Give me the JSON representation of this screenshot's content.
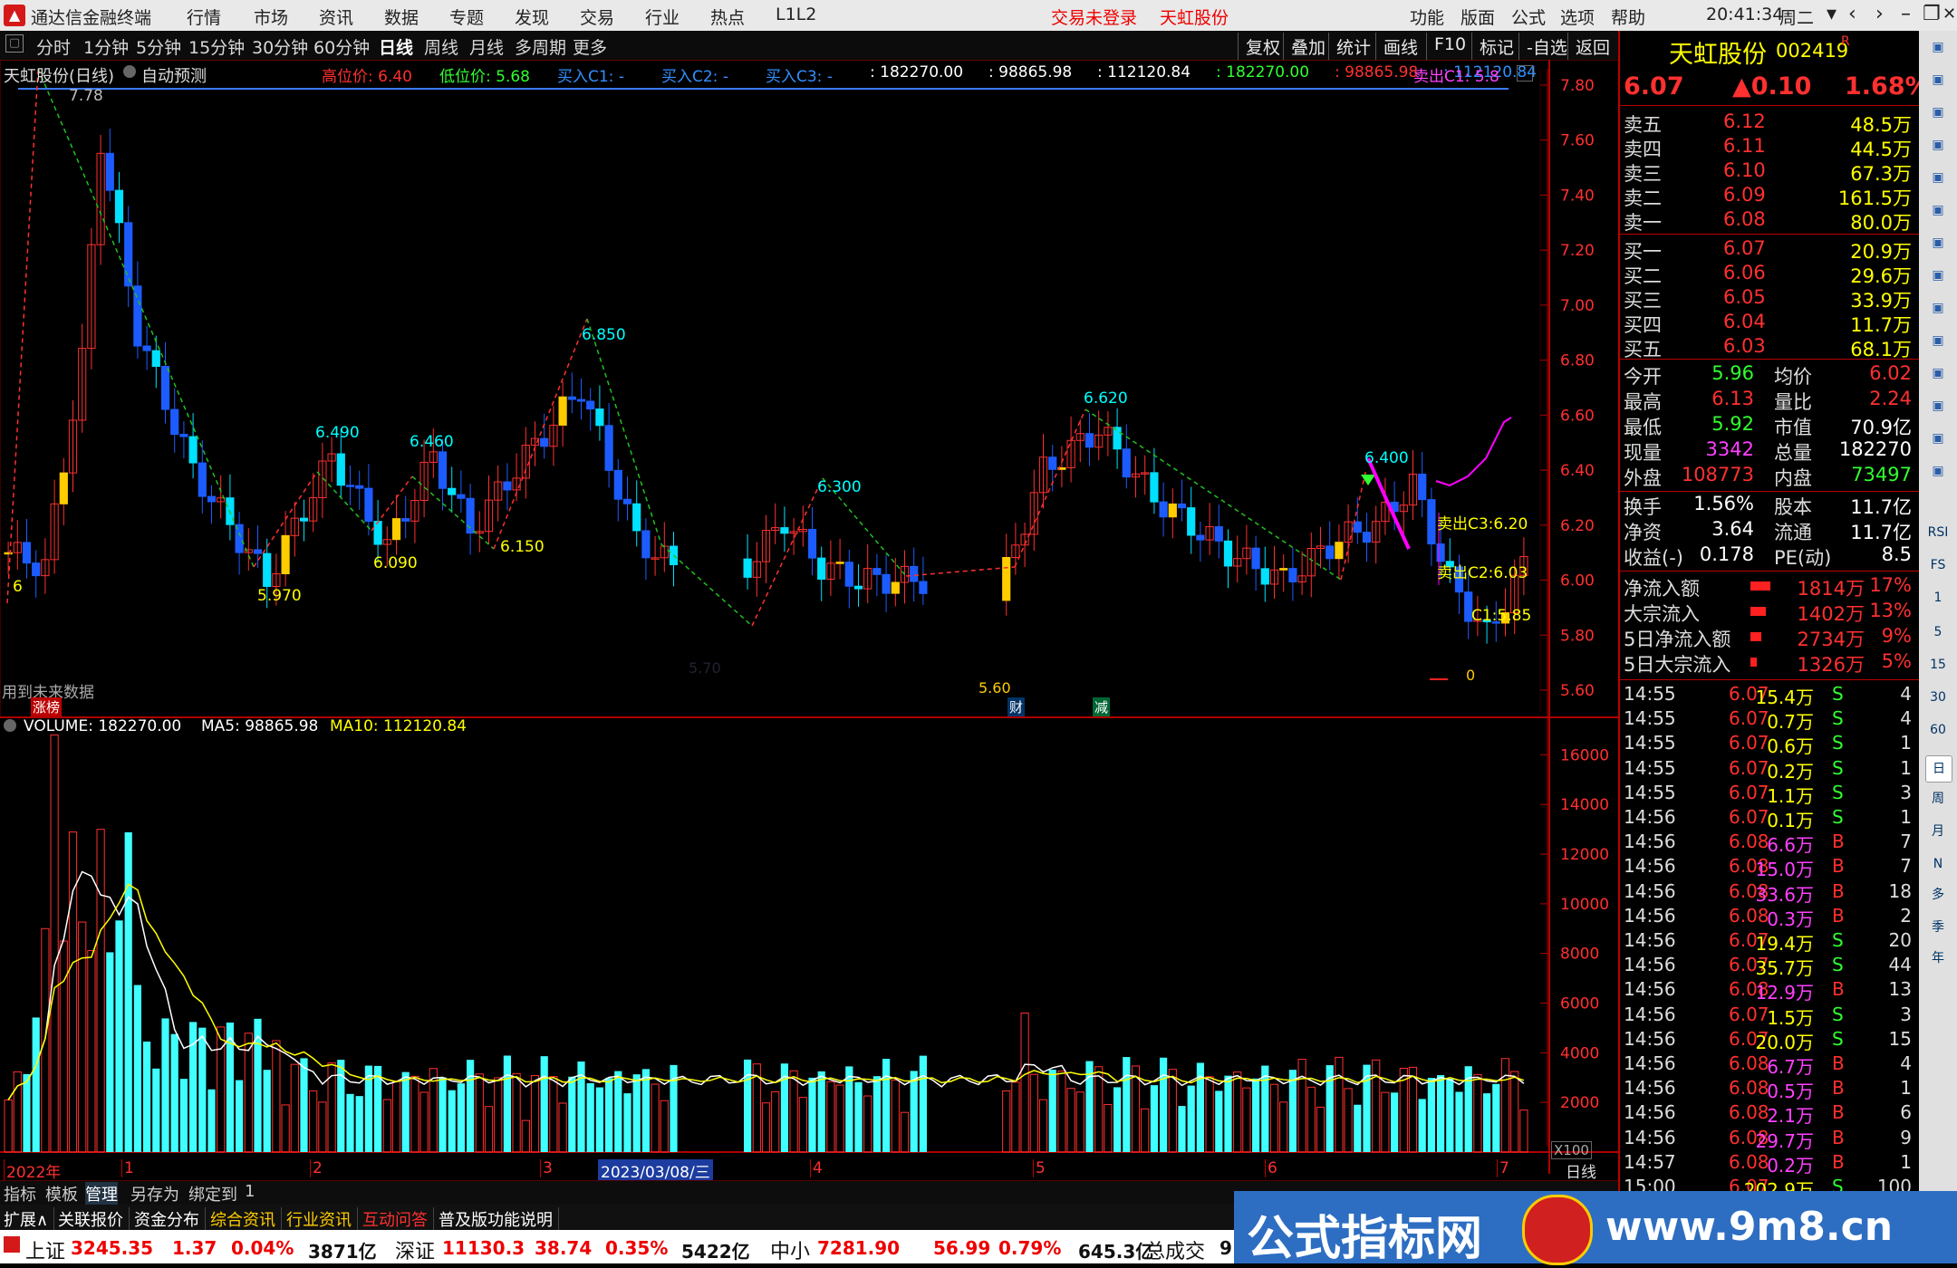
{
  "app": {
    "name": "通达信金融终端",
    "menu": [
      "行情",
      "市场",
      "资讯",
      "数据",
      "专题",
      "发现",
      "交易",
      "行业",
      "热点",
      "L1L2"
    ],
    "status_msg": "交易未登录",
    "stock_msg": "天虹股份",
    "right_menu": [
      "功能",
      "版面",
      "公式",
      "选项",
      "帮助"
    ],
    "clock": "20:41:34",
    "weekday": "周二"
  },
  "toolbar": {
    "periods": [
      "分时",
      "1分钟",
      "5分钟",
      "15分钟",
      "30分钟",
      "60分钟",
      "日线",
      "周线",
      "月线",
      "多周期",
      "更多"
    ],
    "active_period": "日线",
    "right_buttons": [
      "复权",
      "叠加",
      "统计",
      "画线",
      "F10",
      "标记",
      "-自选",
      "返回"
    ]
  },
  "chart": {
    "header_left": "天虹股份(日线)",
    "auto_predict": "自动预测",
    "info": [
      {
        "label": "高位价:",
        "value": "6.40",
        "color": "#ff3030"
      },
      {
        "label": "低位价:",
        "value": "5.68",
        "color": "#30ff30"
      },
      {
        "label": "买入C1:",
        "value": "-",
        "color": "#3090ff"
      },
      {
        "label": "买入C2:",
        "value": "-",
        "color": "#3090ff"
      },
      {
        "label": "买入C3:",
        "value": "-",
        "color": "#3090ff"
      },
      {
        "label": ":",
        "value": "182270.00",
        "color": "#ffffff"
      },
      {
        "label": ":",
        "value": "98865.98",
        "color": "#ffffff"
      },
      {
        "label": ":",
        "value": "112120.84",
        "color": "#ffffff"
      },
      {
        "label": ":",
        "value": "182270.00",
        "color": "#30ff30"
      },
      {
        "label": ":",
        "value": "98865.98",
        "color": "#ff3030"
      },
      {
        "label": ":",
        "value": "112120.84",
        "color": "#3090ff"
      }
    ],
    "sell_c1": "卖出C1: 5.8",
    "y_ticks": [
      "7.80",
      "7.60",
      "7.40",
      "7.20",
      "7.00",
      "6.80",
      "6.60",
      "6.40",
      "6.20",
      "6.00",
      "5.80",
      "5.60"
    ],
    "peak_labels": [
      "7.78",
      "6.490",
      "6.460",
      "6.850",
      "6.300",
      "6.620",
      "6.400"
    ],
    "trough_labels": [
      "6",
      "5.970",
      "6.090",
      "6.150",
      "5.60"
    ],
    "sell_labels": [
      "卖出C3:6.20",
      "卖出C2:6.03",
      "C1:5.85"
    ],
    "misc_labels": {
      "future_data": "用到未来数据",
      "zt": "涨榜",
      "cai": "财",
      "jian": "减",
      "low_ann": "5.60",
      "zero": "0",
      "bottom_price": "5.70"
    }
  },
  "volume": {
    "header": "VOLUME: 182270.00",
    "ma5": "MA5: 98865.98",
    "ma10": "MA10: 112120.84",
    "y_ticks": [
      "16000",
      "14000",
      "12000",
      "10000",
      "8000",
      "6000",
      "4000",
      "2000"
    ],
    "unit": "X100"
  },
  "time_axis": {
    "labels": [
      "2022年",
      "1",
      "2",
      "3",
      "4",
      "5",
      "6",
      "7"
    ],
    "cursor_date": "2023/03/08/三",
    "period": "日线"
  },
  "tabs_bottom": [
    "指标",
    "模板",
    "管理",
    "另存为",
    "绑定到",
    "1"
  ],
  "tabs_bottom2": [
    "扩展∧",
    "关联报价",
    "资金分布",
    "综合资讯",
    "行业资讯",
    "互动问答",
    "普及版功能说明"
  ],
  "stock": {
    "name": "天虹股份",
    "code": "002419",
    "badge": "R",
    "price": "6.07",
    "change": "▲0.10",
    "change_pct": "1.68%",
    "asks": [
      {
        "label": "卖五",
        "price": "6.12",
        "vol": "48.5万"
      },
      {
        "label": "卖四",
        "price": "6.11",
        "vol": "44.5万"
      },
      {
        "label": "卖三",
        "price": "6.10",
        "vol": "67.3万"
      },
      {
        "label": "卖二",
        "price": "6.09",
        "vol": "161.5万"
      },
      {
        "label": "卖一",
        "price": "6.08",
        "vol": "80.0万"
      }
    ],
    "bids": [
      {
        "label": "买一",
        "price": "6.07",
        "vol": "20.9万"
      },
      {
        "label": "买二",
        "price": "6.06",
        "vol": "29.6万"
      },
      {
        "label": "买三",
        "price": "6.05",
        "vol": "33.9万"
      },
      {
        "label": "买四",
        "price": "6.04",
        "vol": "11.7万"
      },
      {
        "label": "买五",
        "price": "6.03",
        "vol": "68.1万"
      }
    ],
    "stats": [
      {
        "l1": "今开",
        "v1": "5.96",
        "c1": "#30ff30",
        "l2": "均价",
        "v2": "6.02",
        "c2": "#ff3030"
      },
      {
        "l1": "最高",
        "v1": "6.13",
        "c1": "#ff3030",
        "l2": "量比",
        "v2": "2.24",
        "c2": "#ff3030"
      },
      {
        "l1": "最低",
        "v1": "5.92",
        "c1": "#30ff30",
        "l2": "市值",
        "v2": "70.9亿",
        "c2": "#ffffff"
      },
      {
        "l1": "现量",
        "v1": "3342",
        "c1": "#ff40ff",
        "l2": "总量",
        "v2": "182270",
        "c2": "#ffffff"
      },
      {
        "l1": "外盘",
        "v1": "108773",
        "c1": "#ff3030",
        "l2": "内盘",
        "v2": "73497",
        "c2": "#30ff30"
      }
    ],
    "stats2": [
      {
        "l1": "换手",
        "v1": "1.56%",
        "l2": "股本",
        "v2": "11.7亿"
      },
      {
        "l1": "净资",
        "v1": "3.64",
        "l2": "流通",
        "v2": "11.7亿"
      },
      {
        "l1": "收益(-)",
        "v1": "0.178",
        "l2": "PE(动)",
        "v2": "8.5"
      }
    ],
    "flows": [
      {
        "label": "净流入额",
        "value": "1814万",
        "pct": "17%",
        "bar": 0.17
      },
      {
        "label": "大宗流入",
        "value": "1402万",
        "pct": "13%",
        "bar": 0.13
      },
      {
        "label": "5日净流入额",
        "value": "2734万",
        "pct": "9%",
        "bar": 0.09
      },
      {
        "label": "5日大宗流入",
        "value": "1326万",
        "pct": "5%",
        "bar": 0.05
      }
    ],
    "ticks": [
      {
        "t": "14:55",
        "p": "6.07",
        "v": "15.4万",
        "s": "S",
        "n": "4"
      },
      {
        "t": "14:55",
        "p": "6.07",
        "v": "0.7万",
        "s": "S",
        "n": "4"
      },
      {
        "t": "14:55",
        "p": "6.07",
        "v": "0.6万",
        "s": "S",
        "n": "1"
      },
      {
        "t": "14:55",
        "p": "6.07",
        "v": "0.2万",
        "s": "S",
        "n": "1"
      },
      {
        "t": "14:55",
        "p": "6.07",
        "v": "1.1万",
        "s": "S",
        "n": "3"
      },
      {
        "t": "14:56",
        "p": "6.07",
        "v": "0.1万",
        "s": "S",
        "n": "1"
      },
      {
        "t": "14:56",
        "p": "6.08",
        "v": "6.6万",
        "s": "B",
        "n": "7"
      },
      {
        "t": "14:56",
        "p": "6.08",
        "v": "15.0万",
        "s": "B",
        "n": "7"
      },
      {
        "t": "14:56",
        "p": "6.08",
        "v": "33.6万",
        "s": "B",
        "n": "18"
      },
      {
        "t": "14:56",
        "p": "6.08",
        "v": "0.3万",
        "s": "B",
        "n": "2"
      },
      {
        "t": "14:56",
        "p": "6.07",
        "v": "19.4万",
        "s": "S",
        "n": "20"
      },
      {
        "t": "14:56",
        "p": "6.07",
        "v": "35.7万",
        "s": "S",
        "n": "44"
      },
      {
        "t": "14:56",
        "p": "6.08",
        "v": "12.9万",
        "s": "B",
        "n": "13"
      },
      {
        "t": "14:56",
        "p": "6.07",
        "v": "1.5万",
        "s": "S",
        "n": "3"
      },
      {
        "t": "14:56",
        "p": "6.07",
        "v": "20.0万",
        "s": "S",
        "n": "15"
      },
      {
        "t": "14:56",
        "p": "6.08",
        "v": "6.7万",
        "s": "B",
        "n": "4"
      },
      {
        "t": "14:56",
        "p": "6.08",
        "v": "0.5万",
        "s": "B",
        "n": "1"
      },
      {
        "t": "14:56",
        "p": "6.08",
        "v": "2.1万",
        "s": "B",
        "n": "6"
      },
      {
        "t": "14:56",
        "p": "6.08",
        "v": "29.7万",
        "s": "B",
        "n": "9"
      },
      {
        "t": "14:57",
        "p": "6.08",
        "v": "0.2万",
        "s": "B",
        "n": "1"
      },
      {
        "t": "15:00",
        "p": "6.07",
        "v": "202.9万",
        "s": "S",
        "n": "100"
      }
    ]
  },
  "sidebar_labels": [
    "RSI",
    "FS",
    "1",
    "5",
    "15",
    "30",
    "60",
    "日",
    "周",
    "月",
    "N",
    "多",
    "季",
    "年"
  ],
  "index_bar": [
    {
      "name": "上证",
      "value": "3245.35",
      "chg": "1.37",
      "pct": "0.04%",
      "amt": "3871亿"
    },
    {
      "name": "深证",
      "value": "11130.3",
      "chg": "38.74",
      "pct": "0.35%",
      "amt": "5422亿"
    },
    {
      "name": "中小",
      "value": "7281.90",
      "chg": "56.99",
      "pct": "0.79%",
      "amt": "645.3亿"
    }
  ],
  "index_tail": "总成交",
  "index_tail_value": "9",
  "watermark": {
    "text": "公式指标网",
    "url": "www.9m8.cn"
  },
  "colors": {
    "up": "#ff3030",
    "down": "#00ffff",
    "yellow": "#ffcc00",
    "blue": "#1c5cff",
    "green": "#30ff30",
    "panel_border": "#b00000"
  },
  "chart_data": {
    "type": "candlestick",
    "price_range": [
      5.6,
      7.8
    ],
    "candles": [
      [
        6.1,
        6.22,
        6.3,
        6.0
      ],
      [
        6.22,
        6.08,
        6.25,
        6.0
      ],
      [
        6.08,
        6.6,
        6.8,
        6.05
      ],
      [
        6.6,
        7.1,
        7.3,
        6.5
      ],
      [
        7.1,
        7.65,
        7.78,
        7.0
      ],
      [
        7.6,
        6.95,
        7.65,
        6.9
      ],
      [
        6.95,
        6.75,
        7.05,
        6.7
      ],
      [
        6.75,
        6.65,
        6.95,
        6.6
      ],
      [
        6.65,
        6.78,
        6.9,
        6.55
      ],
      [
        6.78,
        6.6,
        6.85,
        6.5
      ],
      [
        6.6,
        6.7,
        6.9,
        6.55
      ],
      [
        6.7,
        6.55,
        6.75,
        6.45
      ],
      [
        6.55,
        6.45,
        6.6,
        6.4
      ],
      [
        6.45,
        6.3,
        6.5,
        6.25
      ],
      [
        6.3,
        6.2,
        6.35,
        6.15
      ],
      [
        6.2,
        6.15,
        6.3,
        6.1
      ],
      [
        6.15,
        6.05,
        6.2,
        6.0
      ],
      [
        6.05,
        6.12,
        6.2,
        6.02
      ],
      [
        6.12,
        6.05,
        6.15,
        6.0
      ],
      [
        6.05,
        6.0,
        6.1,
        5.97
      ],
      [
        6.0,
        6.05,
        6.12,
        5.97
      ],
      [
        6.05,
        6.15,
        6.2,
        6.02
      ],
      [
        6.15,
        6.22,
        6.3,
        6.1
      ],
      [
        6.22,
        6.3,
        6.42,
        6.18
      ],
      [
        6.3,
        6.45,
        6.49,
        6.25
      ],
      [
        6.45,
        6.25,
        6.48,
        6.2
      ],
      [
        6.25,
        6.12,
        6.3,
        6.1
      ],
      [
        6.12,
        6.1,
        6.2,
        6.09
      ],
      [
        6.1,
        6.18,
        6.25,
        6.08
      ],
      [
        6.18,
        6.25,
        6.35,
        6.15
      ],
      [
        6.25,
        6.38,
        6.46,
        6.2
      ],
      [
        6.38,
        6.3,
        6.4,
        6.2
      ],
      [
        6.3,
        6.18,
        6.35,
        6.15
      ],
      [
        6.18,
        6.22,
        6.3,
        6.15
      ],
      [
        6.22,
        6.2,
        6.3,
        6.15
      ],
      [
        6.2,
        6.3,
        6.4,
        6.15
      ],
      [
        6.3,
        6.45,
        6.55,
        6.25
      ],
      [
        6.45,
        6.5,
        6.6,
        6.4
      ],
      [
        6.5,
        6.42,
        6.55,
        6.38
      ],
      [
        6.42,
        6.38,
        6.5,
        6.35
      ],
      [
        6.38,
        6.45,
        6.55,
        6.35
      ],
      [
        6.45,
        6.7,
        6.85,
        6.4
      ],
      [
        6.7,
        6.45,
        6.75,
        6.4
      ],
      [
        6.45,
        6.3,
        6.5,
        6.25
      ],
      [
        6.3,
        6.2,
        6.35,
        6.15
      ],
      [
        6.2,
        6.05,
        6.25,
        6.02
      ],
      [
        6.05,
        6.02,
        6.1,
        6.0
      ],
      [
        6.02,
        6.0,
        6.08,
        5.98
      ],
      [
        6.0,
        6.05,
        6.1,
        5.98
      ],
      [
        6.05,
        6.0,
        6.1,
        5.98
      ]
    ]
  }
}
